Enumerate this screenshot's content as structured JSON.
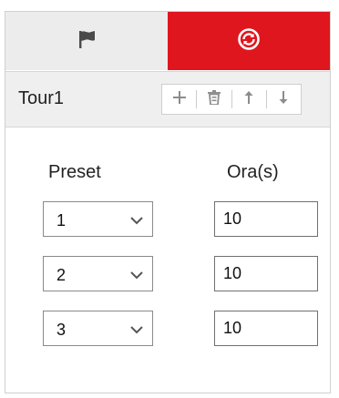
{
  "tabs": [
    {
      "icon": "flag-icon",
      "active": false
    },
    {
      "icon": "refresh-icon",
      "active": true
    }
  ],
  "colors": {
    "accent": "#e0161e",
    "inactive_tab": "#ececec",
    "toolbar_bg": "#efefef",
    "icon_gray": "#8c8c8c"
  },
  "tour": {
    "name": "Tour1",
    "tools": [
      "plus-icon",
      "trash-icon",
      "arrow-up-icon",
      "arrow-down-icon"
    ]
  },
  "columns": {
    "preset": "Preset",
    "time": "Ora(s)"
  },
  "rows": [
    {
      "preset": "1",
      "time": "10"
    },
    {
      "preset": "2",
      "time": "10"
    },
    {
      "preset": "3",
      "time": "10"
    }
  ]
}
